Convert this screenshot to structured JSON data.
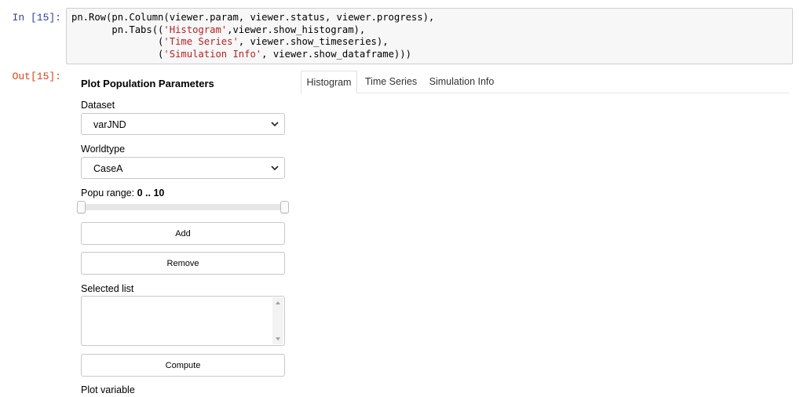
{
  "cell": {
    "in_prompt": "In [15]:",
    "out_prompt": "Out[15]:",
    "code": {
      "line1": "pn.Row(pn.Column(viewer.param, viewer.status, viewer.progress),",
      "line2_pre": "       pn.Tabs((",
      "line2_str": "'Histogram'",
      "line2_post": ",viewer.show_histogram),",
      "line3_pre": "               (",
      "line3_str": "'Time Series'",
      "line3_post": ", viewer.show_timeseries),",
      "line4_pre": "               (",
      "line4_str": "'Simulation Info'",
      "line4_post": ", viewer.show_dataframe)))"
    }
  },
  "panel": {
    "title": "Plot Population Parameters",
    "dataset": {
      "label": "Dataset",
      "value": "varJND"
    },
    "worldtype": {
      "label": "Worldtype",
      "value": "CaseA"
    },
    "popu_range": {
      "label": "Popu range: ",
      "min_label": "0",
      "separator": " .. ",
      "max_label": "10",
      "low": 0,
      "high": 10
    },
    "add_button": "Add",
    "remove_button": "Remove",
    "selected_list": {
      "label": "Selected list"
    },
    "compute_button": "Compute",
    "plot_variable": {
      "label": "Plot variable"
    }
  },
  "tabs": [
    {
      "label": "Histogram",
      "active": true
    },
    {
      "label": "Time Series",
      "active": false
    },
    {
      "label": "Simulation Info",
      "active": false
    }
  ],
  "colors": {
    "in_prompt": "#303f9f",
    "out_prompt": "#d84315",
    "string": "#ba2121"
  }
}
